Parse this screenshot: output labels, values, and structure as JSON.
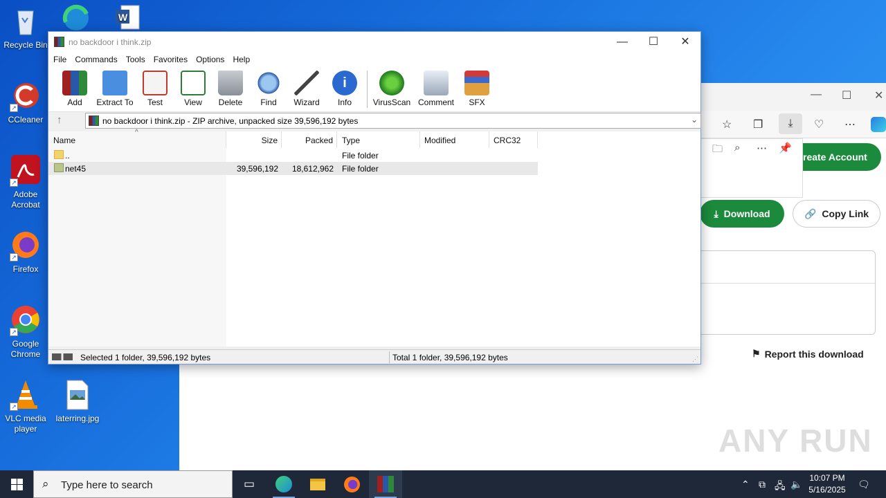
{
  "desktop": {
    "icons": [
      {
        "label": "Recycle Bin"
      },
      {
        "label": "CCleaner"
      },
      {
        "label": "Adobe Acrobat"
      },
      {
        "label": "Firefox"
      },
      {
        "label": "Google Chrome"
      },
      {
        "label": "VLC media player"
      },
      {
        "label": "laterring.jpg"
      }
    ]
  },
  "browser": {
    "create_account": "reate Account",
    "download": "Download",
    "copy_link": "Copy Link",
    "report": "Report this download"
  },
  "winrar": {
    "title": "no backdoor i think.zip",
    "menu": [
      "File",
      "Commands",
      "Tools",
      "Favorites",
      "Options",
      "Help"
    ],
    "toolbar": [
      "Add",
      "Extract To",
      "Test",
      "View",
      "Delete",
      "Find",
      "Wizard",
      "Info",
      "VirusScan",
      "Comment",
      "SFX"
    ],
    "address": "no backdoor i think.zip - ZIP archive, unpacked size 39,596,192 bytes",
    "columns": [
      "Name",
      "Size",
      "Packed",
      "Type",
      "Modified",
      "CRC32"
    ],
    "rows": [
      {
        "name": "..",
        "size": "",
        "packed": "",
        "type": "File folder"
      },
      {
        "name": "net45",
        "size": "39,596,192",
        "packed": "18,612,962",
        "type": "File folder"
      }
    ],
    "status_left": "Selected 1 folder, 39,596,192 bytes",
    "status_right": "Total 1 folder, 39,596,192 bytes"
  },
  "taskbar": {
    "search_placeholder": "Type here to search",
    "time": "10:07 PM",
    "date": "5/16/2025"
  },
  "watermark": "ANY RUN"
}
